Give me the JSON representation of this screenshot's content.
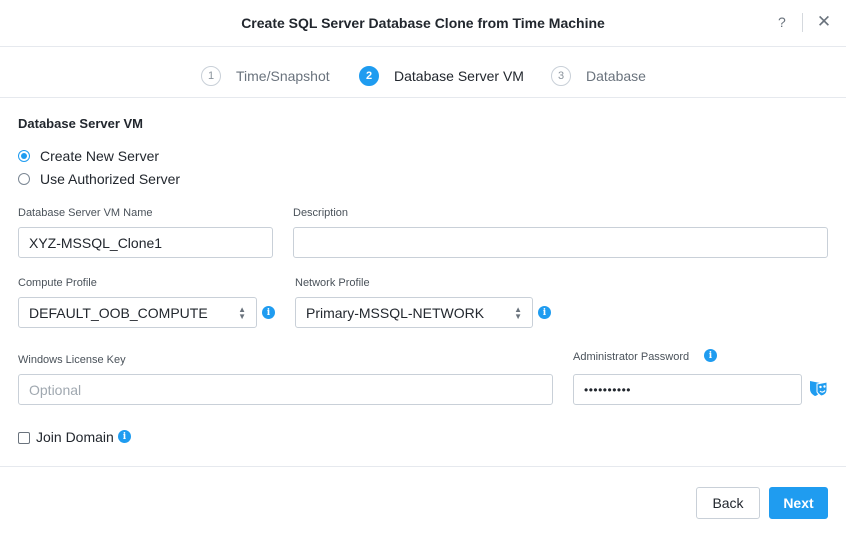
{
  "dialog": {
    "title": "Create SQL Server Database Clone from Time Machine",
    "help_label": "?",
    "close_label": "✕"
  },
  "steps": [
    {
      "number": "1",
      "label": "Time/Snapshot"
    },
    {
      "number": "2",
      "label": "Database Server VM"
    },
    {
      "number": "3",
      "label": "Database"
    }
  ],
  "form": {
    "section_title": "Database Server VM",
    "server_options": [
      {
        "label": "Create New Server",
        "selected": true
      },
      {
        "label": "Use Authorized Server",
        "selected": false
      }
    ],
    "vm_name": {
      "label": "Database Server VM Name",
      "value": "XYZ-MSSQL_Clone1"
    },
    "description": {
      "label": "Description",
      "value": ""
    },
    "compute_profile": {
      "label": "Compute Profile",
      "value": "DEFAULT_OOB_COMPUTE"
    },
    "network_profile": {
      "label": "Network Profile",
      "value": "Primary-MSSQL-NETWORK"
    },
    "license_key": {
      "label": "Windows License Key",
      "placeholder": "Optional"
    },
    "admin_password": {
      "label": "Administrator Password",
      "value": "••••••••••"
    },
    "join_domain": {
      "label": "Join Domain",
      "checked": false
    },
    "info_glyph": "i"
  },
  "footer": {
    "back_label": "Back",
    "next_label": "Next"
  },
  "colors": {
    "accent": "#1f9cf0",
    "border": "#c9d0d8"
  }
}
